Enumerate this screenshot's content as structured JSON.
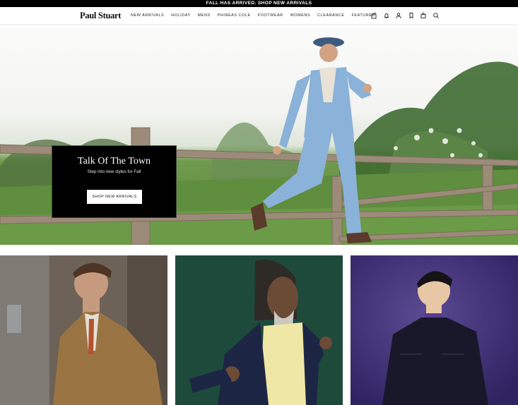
{
  "announcement": {
    "text": "FALL HAS ARRIVED. SHOP NEW ARRIVALS"
  },
  "header": {
    "logo": "Paul Stuart",
    "nav": [
      "NEW ARRIVALS",
      "HOLIDAY",
      "MENS",
      "PHINEAS COLE",
      "FOOTWEAR",
      "WOMENS",
      "CLEARANCE",
      "FEATURED"
    ],
    "icons": [
      "gift-icon",
      "bell-icon",
      "user-icon",
      "bookmark-icon",
      "bag-icon",
      "search-icon"
    ]
  },
  "hero": {
    "promo": {
      "title": "Talk Of The Town",
      "subtitle": "Step into new styles for Fall",
      "button": "SHOP NEW ARRIVALS"
    }
  },
  "colors": {
    "black": "#000000",
    "white": "#ffffff",
    "sky": "#f6f6f4",
    "grass": "#5f8e3e",
    "suit_blue": "#8bb2d8",
    "tile_green": "#1e4a3b",
    "tile_purple": "#3a2a6a",
    "barn_wood": "#6d6258"
  }
}
